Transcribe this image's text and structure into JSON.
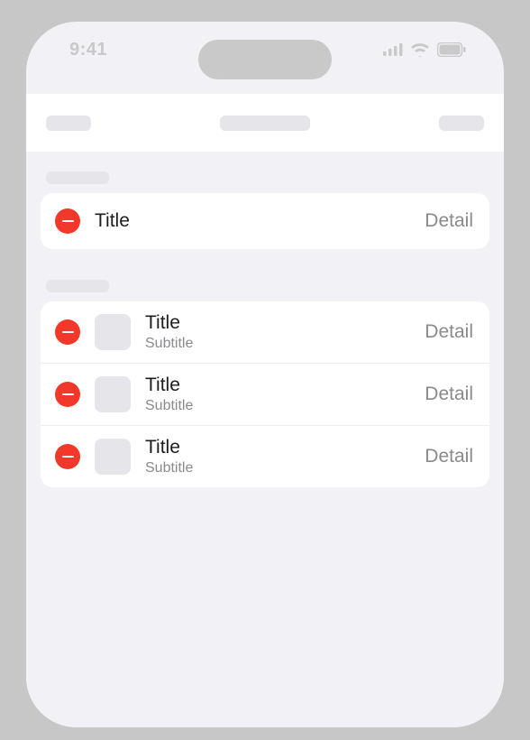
{
  "statusbar": {
    "time": "9:41"
  },
  "section1": {
    "rows": [
      {
        "title": "Title",
        "detail": "Detail"
      }
    ]
  },
  "section2": {
    "rows": [
      {
        "title": "Title",
        "subtitle": "Subtitle",
        "detail": "Detail"
      },
      {
        "title": "Title",
        "subtitle": "Subtitle",
        "detail": "Detail"
      },
      {
        "title": "Title",
        "subtitle": "Subtitle",
        "detail": "Detail"
      }
    ]
  }
}
